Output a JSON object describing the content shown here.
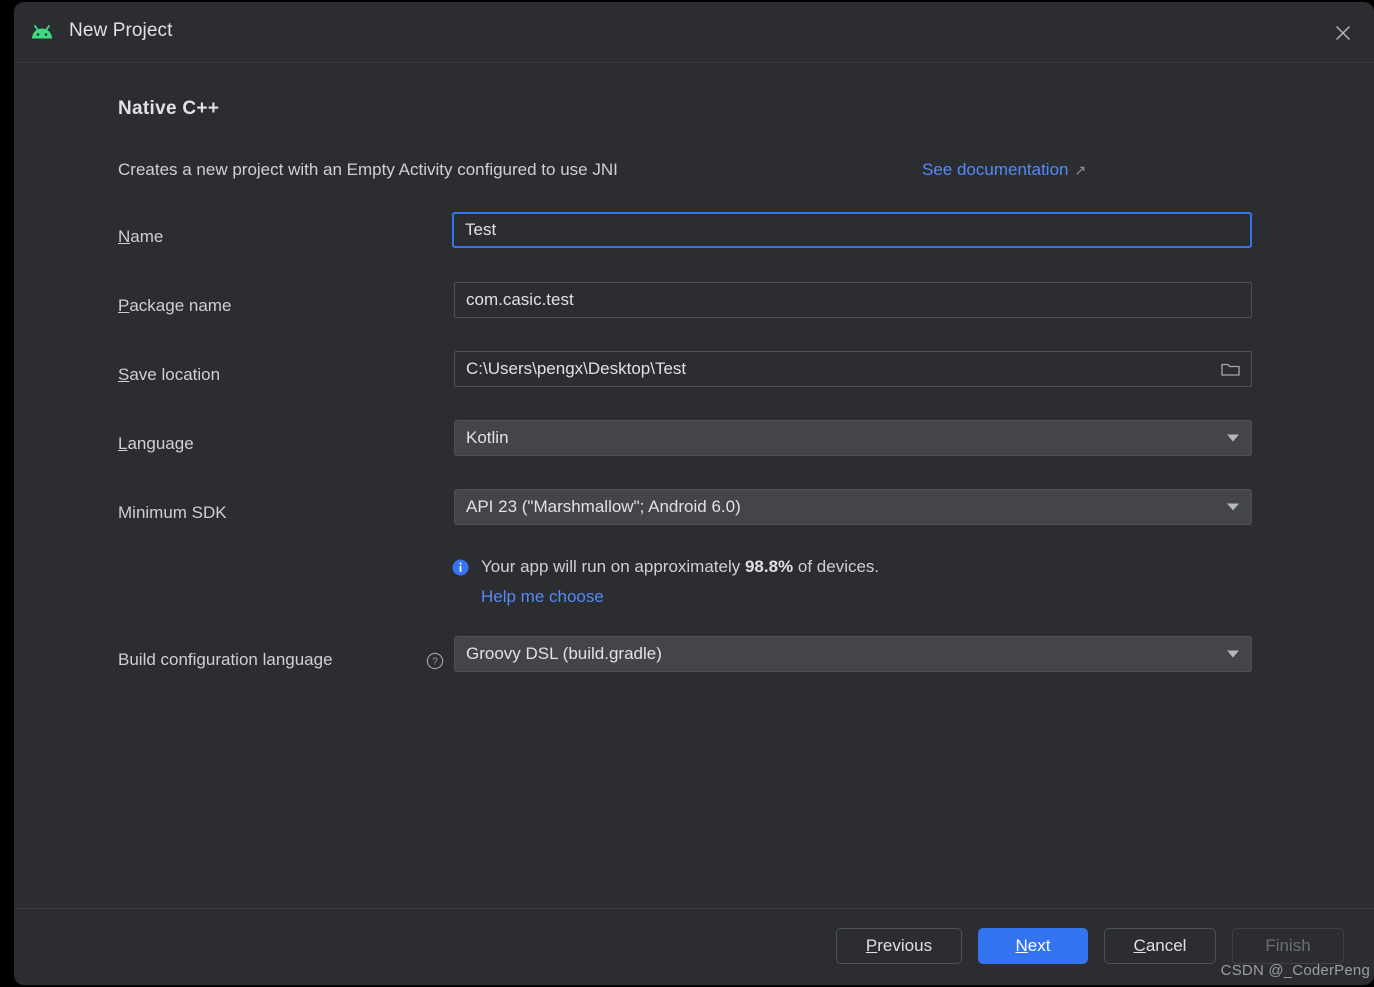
{
  "window": {
    "title": "New Project",
    "app_icon": "android-robot-icon",
    "close_icon": "close-icon"
  },
  "content": {
    "template_name": "Native C++",
    "description": "Creates a new project with an Empty Activity configured to use JNI",
    "documentation_link": "See documentation",
    "documentation_link_icon": "external-link-arrow-icon"
  },
  "fields": {
    "name": {
      "label": "Name",
      "mnemonic": "N",
      "value": "Test",
      "focused": true
    },
    "package_name": {
      "label": "Package name",
      "mnemonic": "P",
      "value": "com.casic.test"
    },
    "save_location": {
      "label": "Save location",
      "mnemonic": "S",
      "value": "C:\\Users\\pengx\\Desktop\\Test",
      "browse_icon": "folder-icon"
    },
    "language": {
      "label": "Language",
      "mnemonic": "L",
      "value": "Kotlin"
    },
    "minimum_sdk": {
      "label": "Minimum SDK",
      "value": "API 23 (\"Marshmallow\"; Android 6.0)"
    },
    "build_config_language": {
      "label": "Build configuration language",
      "help_icon": "help-circle-icon",
      "value": "Groovy DSL (build.gradle)"
    }
  },
  "sdk_info": {
    "icon": "info-icon",
    "text_before": "Your app will run on approximately ",
    "percentage": "98.8%",
    "text_after": " of devices.",
    "help_link": "Help me choose"
  },
  "footer": {
    "previous": "Previous",
    "previous_mnemonic": "P",
    "next": "Next",
    "next_mnemonic": "N",
    "cancel": "Cancel",
    "cancel_mnemonic": "C",
    "finish": "Finish",
    "finish_disabled": true
  },
  "watermark": "CSDN @_CoderPeng",
  "colors": {
    "accent": "#3574f0",
    "link": "#548af7",
    "dialog_bg": "#2b2d30",
    "android_green": "#3ddc84"
  }
}
